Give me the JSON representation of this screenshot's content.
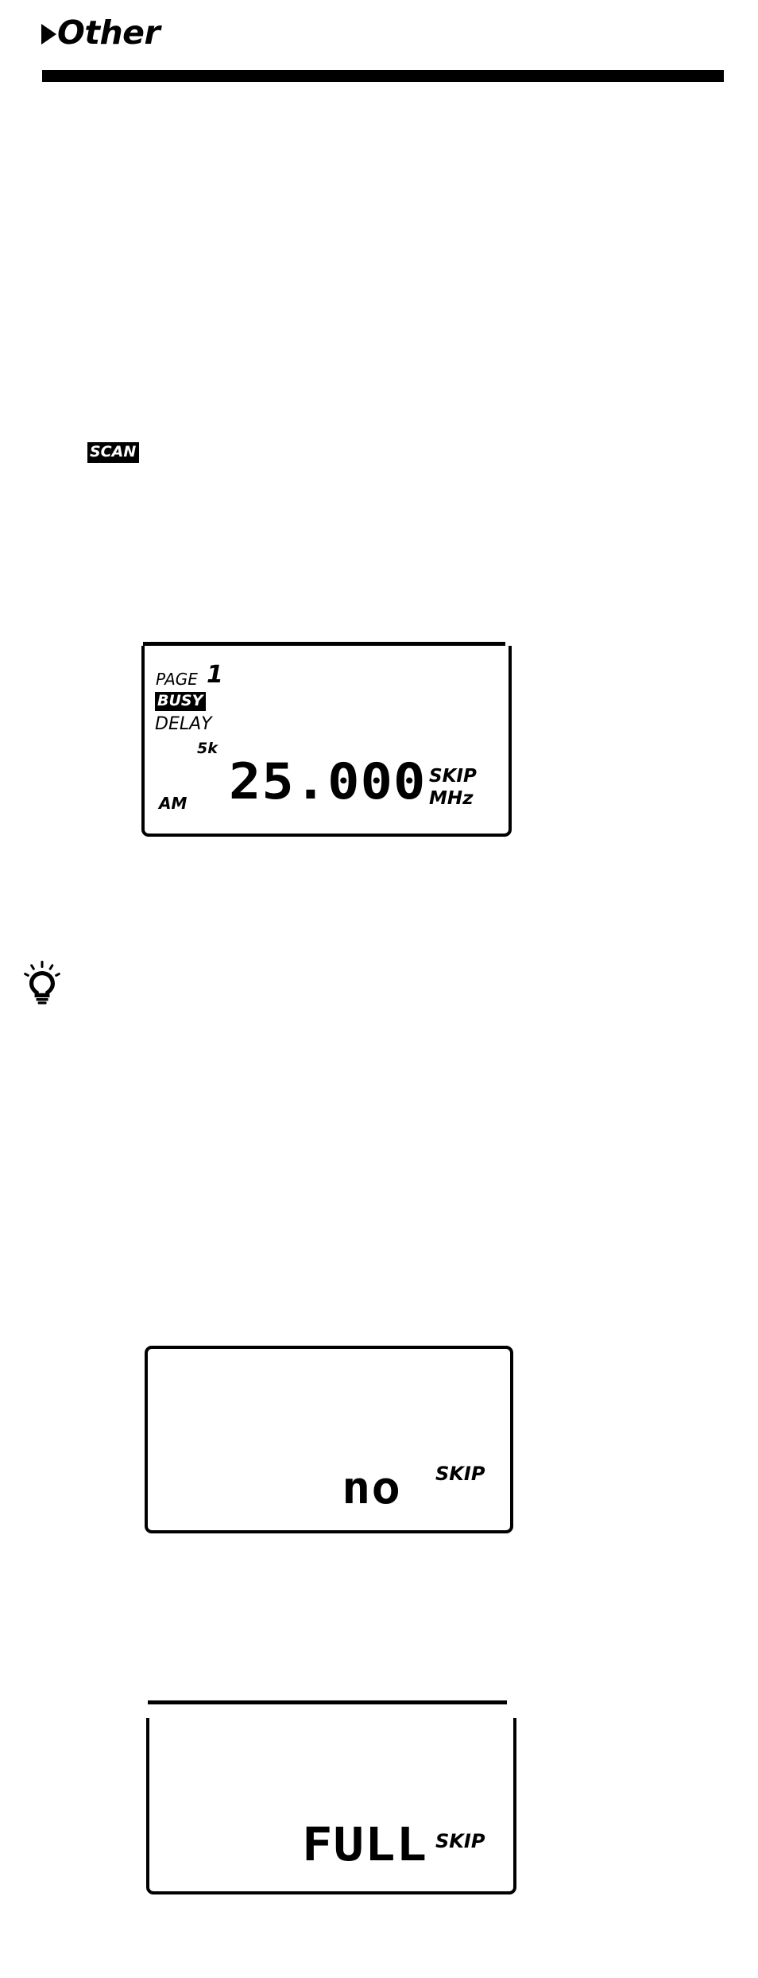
{
  "page": {
    "section_header": "Other",
    "header_arrow_icon": "right-triangle-icon"
  },
  "badges": {
    "scan": "SCAN"
  },
  "tip": {
    "icon": "lightbulb-icon"
  },
  "displays": [
    {
      "id": "lcd-display-1",
      "page_label": "PAGE",
      "page_number": "1",
      "busy_indicator": "BUSY",
      "delay_indicator": "DELAY",
      "step_indicator": "5k",
      "mode_indicator": "AM",
      "frequency": "25.000",
      "skip_indicator": "SKIP",
      "unit": "MHz"
    },
    {
      "id": "lcd-display-2",
      "value": "no",
      "skip_indicator": "SKIP"
    },
    {
      "id": "lcd-display-3",
      "value": "FULL",
      "skip_indicator": "SKIP"
    }
  ],
  "colors": {
    "ink": "#000000",
    "paper": "#ffffff"
  }
}
